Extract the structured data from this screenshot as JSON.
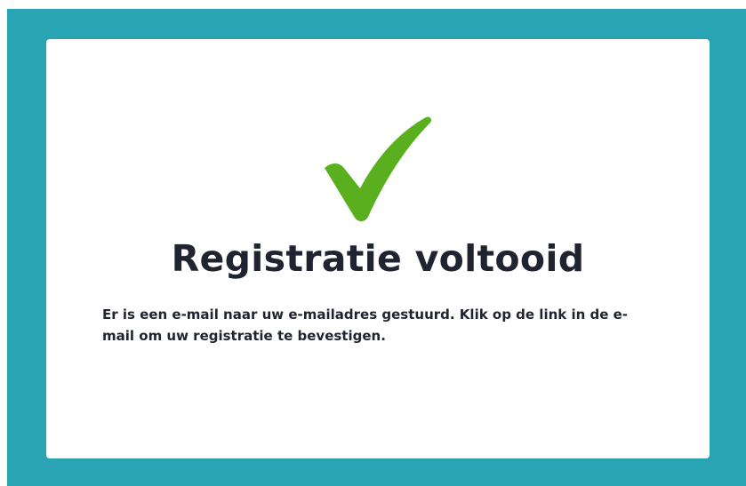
{
  "page": {
    "background_color": "#29a4b2",
    "card_color": "#ffffff"
  },
  "confirmation": {
    "icon": "checkmark-icon",
    "icon_color": "#5aaf1e",
    "title": "Registratie voltooid",
    "message": "Er is een e-mail naar uw e-mailadres gestuurd. Klik op de link in de e-mail om uw registratie te bevestigen."
  }
}
